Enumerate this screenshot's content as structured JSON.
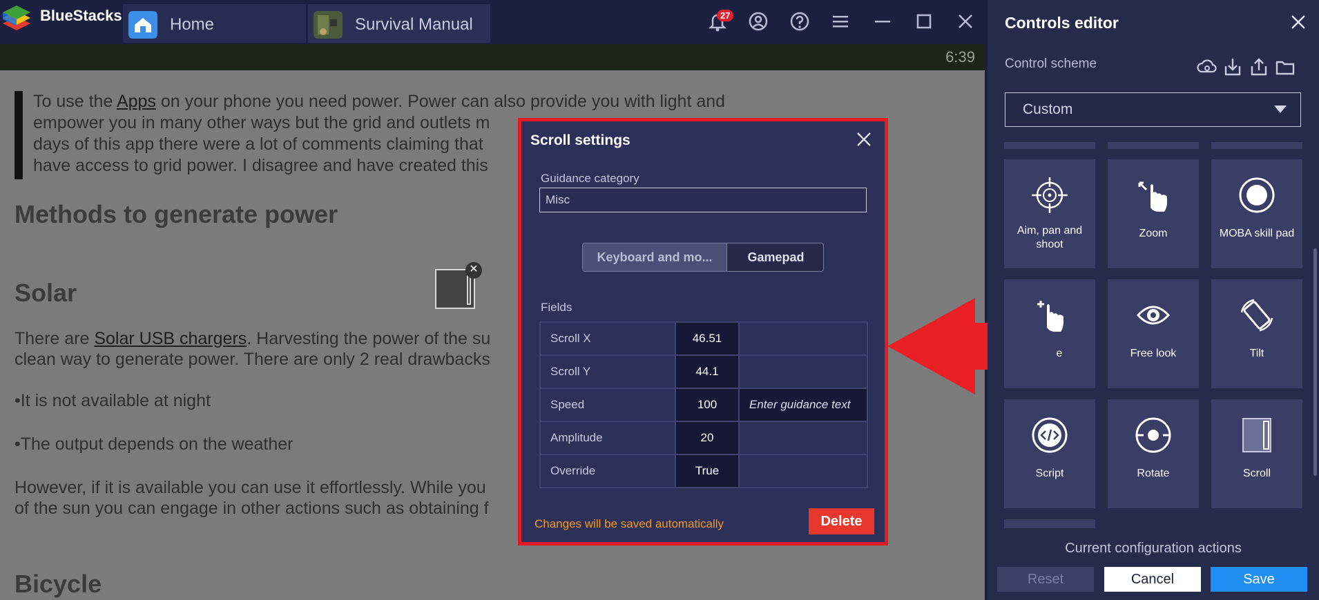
{
  "titlebar": {
    "brand": "BlueStacks",
    "tabs": [
      {
        "label": "Home"
      },
      {
        "label": "Survival Manual"
      }
    ],
    "notification_count": "27"
  },
  "emulator": {
    "clock": "6:39",
    "quote_lines": [
      {
        "pre": "To use the ",
        "link": "Apps",
        "post": " on your phone you need power. Power can also provide you with light and"
      },
      {
        "text": "empower you in many other ways but the grid and outlets m"
      },
      {
        "text": "days of this app there were a lot of comments claiming that"
      },
      {
        "text": "have access to grid power. I disagree and have created this"
      }
    ],
    "heading_methods": "Methods to generate power",
    "heading_solar": "Solar",
    "solar_para": {
      "pre": "There are ",
      "link": "Solar USB chargers",
      "post": ". Harvesting the power of the su",
      "line2": "clean way to generate power. There are only 2 real drawbacks"
    },
    "bullet1": "•It is not available at night",
    "bullet2": "•The output depends on the weather",
    "however_line1": "However, if it is available you can use it effortlessly. While you",
    "however_line2": "of the sun you can engage in other actions such as obtaining f",
    "heading_bicycle": "Bicycle"
  },
  "dialog": {
    "title": "Scroll settings",
    "guidance_label": "Guidance category",
    "guidance_value": "Misc",
    "segments": [
      "Keyboard and mo...",
      "Gamepad"
    ],
    "fields_label": "Fields",
    "fields": [
      {
        "name": "Scroll X",
        "value": "46.51",
        "hint": ""
      },
      {
        "name": "Scroll Y",
        "value": "44.1",
        "hint": ""
      },
      {
        "name": "Speed",
        "value": "100",
        "hint": "Enter guidance text"
      },
      {
        "name": "Amplitude",
        "value": "20",
        "hint": ""
      },
      {
        "name": "Override",
        "value": "True",
        "hint": ""
      }
    ],
    "footer_note": "Changes will be saved automatically",
    "delete_label": "Delete"
  },
  "panel": {
    "title": "Controls editor",
    "scheme_label": "Control scheme",
    "scheme_value": "Custom",
    "tiles": [
      {
        "label": "Aim, pan and shoot",
        "icon": "crosshair-icon"
      },
      {
        "label": "Zoom",
        "icon": "pinch-zoom-icon"
      },
      {
        "label": "MOBA skill pad",
        "icon": "skill-pad-icon"
      },
      {
        "label": "e",
        "icon": "swipe-icon"
      },
      {
        "label": "Free look",
        "icon": "eye-icon"
      },
      {
        "label": "Tilt",
        "icon": "tilt-icon"
      },
      {
        "label": "Script",
        "icon": "code-icon"
      },
      {
        "label": "Rotate",
        "icon": "rotate-icon"
      },
      {
        "label": "Scroll",
        "icon": "scroll-icon"
      }
    ],
    "config_label": "Current configuration actions",
    "reset_label": "Reset",
    "cancel_label": "Cancel",
    "save_label": "Save"
  },
  "colors": {
    "accent_red": "#e21b22",
    "save_blue": "#1f8ef2",
    "warning_orange": "#f29a1f"
  }
}
